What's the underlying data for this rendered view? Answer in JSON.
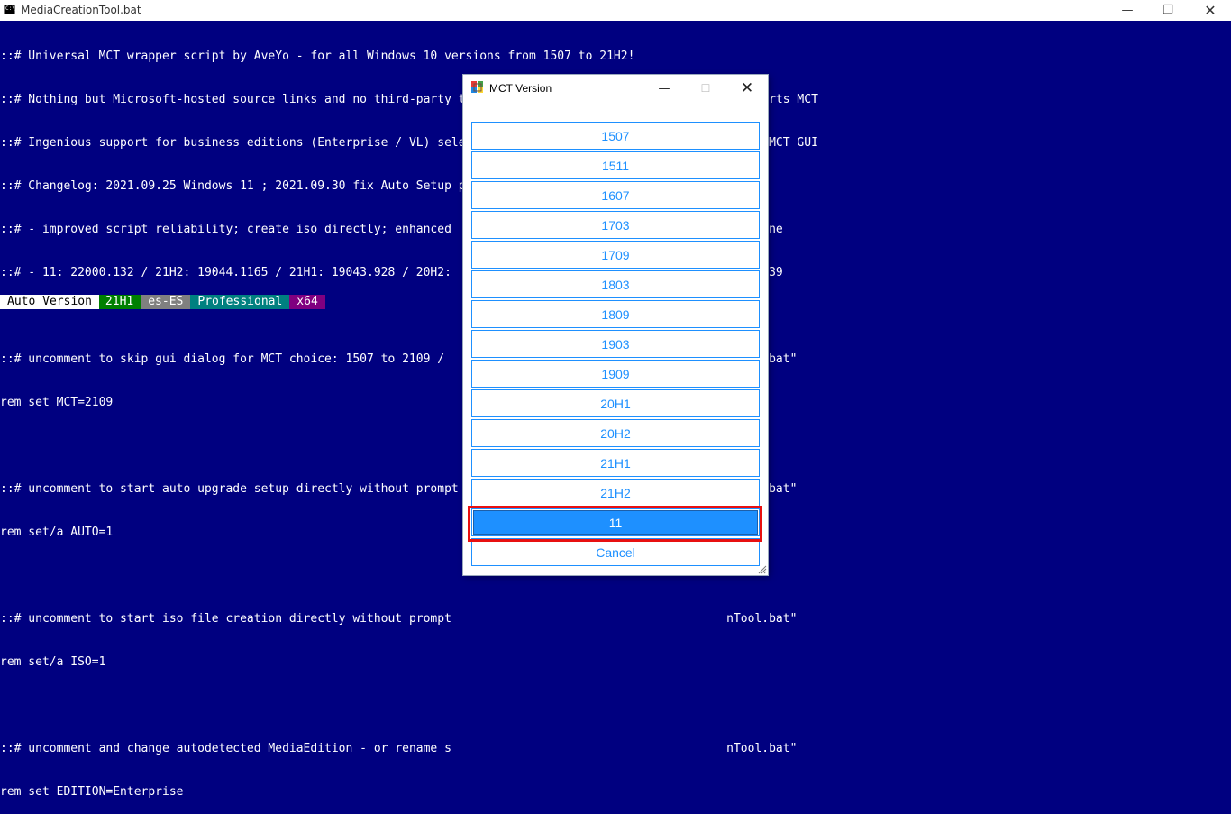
{
  "window": {
    "title": "MediaCreationTool.bat",
    "min_glyph": "—",
    "max_glyph": "❐",
    "close_glyph": "✕"
  },
  "console": {
    "lines": [
      "::# Universal MCT wrapper script by AveYo - for all Windows 10 versions from 1507 to 21H2!",
      "::# Nothing but Microsoft-hosted source links and no third-party tools - script just configures a xml and starts MCT",
      "::# Ingenious support for business editions (Enterprise / VL) selecting language, x86, x64 or AiO inside the MCT GUI",
      "::# Changelog: 2021.09.25 Windows 11 ; 2021.09.30 fix Auto Setup preset not launching",
      "::# - improved script reliability; create iso directly; enhanced                                           line",
      "::# - 11: 22000.132 / 21H2: 19044.1165 / 21H1: 19043.928 / 20H2:                                         3.1139",
      "",
      "::# uncomment to skip gui dialog for MCT choice: 1507 to 2109 /                                        nTool.bat\"",
      "rem set MCT=2109",
      "",
      "::# uncomment to start auto upgrade setup directly without prompt                                      nTool.bat\"",
      "rem set/a AUTO=1",
      "",
      "::# uncomment to start iso file creation directly without prompt                                       nTool.bat\"",
      "rem set/a ISO=1",
      "",
      "::# uncomment and change autodetected MediaEdition - or rename s                                       nTool.bat\"",
      "rem set EDITION=Enterprise"
    ],
    "status": {
      "mode": "Auto Version",
      "version": "21H1",
      "language": "es-ES",
      "edition": "Professional",
      "arch": "x64"
    }
  },
  "dialog": {
    "title": "MCT Version",
    "min_glyph": "—",
    "max_glyph": "☐",
    "close_glyph": "✕",
    "options": [
      "1507",
      "1511",
      "1607",
      "1703",
      "1709",
      "1803",
      "1809",
      "1903",
      "1909",
      "20H1",
      "20H2",
      "21H1",
      "21H2",
      "11",
      "Cancel"
    ],
    "selected": "11"
  }
}
